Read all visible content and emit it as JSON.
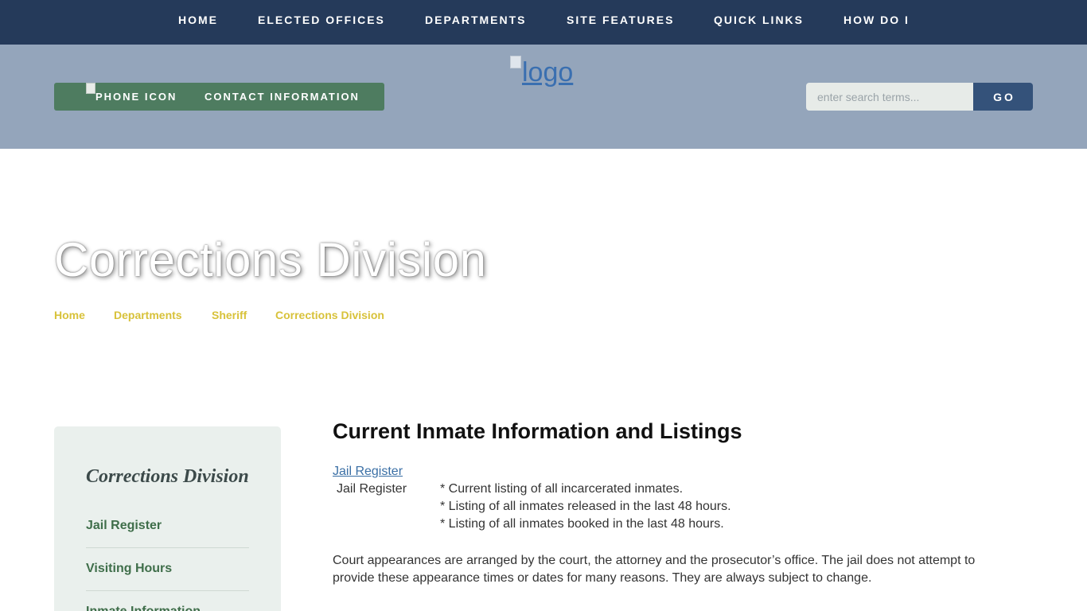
{
  "nav": {
    "items": [
      {
        "label": "HOME"
      },
      {
        "label": "ELECTED OFFICES"
      },
      {
        "label": "DEPARTMENTS"
      },
      {
        "label": "SITE FEATURES"
      },
      {
        "label": "QUICK LINKS"
      },
      {
        "label": "HOW DO I"
      }
    ]
  },
  "header": {
    "contact": {
      "phone_icon_alt": "PHONE ICON",
      "label": "CONTACT INFORMATION"
    },
    "logo_alt": "logo",
    "search": {
      "placeholder": "enter search terms...",
      "button_label": "GO"
    }
  },
  "hero": {
    "title": "Corrections Division",
    "breadcrumb": [
      "Home",
      "Departments",
      "Sheriff",
      "Corrections Division"
    ]
  },
  "sidebar": {
    "title": "Corrections Division",
    "items": [
      "Jail Register",
      "Visiting Hours",
      "Inmate Information"
    ]
  },
  "main": {
    "heading": "Current Inmate Information and Listings",
    "jail_link": "Jail Register",
    "jail_label": "Jail Register",
    "jail_items": [
      "* Current listing of all incarcerated inmates.",
      "* Listing of all inmates released in the last 48 hours.",
      "* Listing of all inmates booked in the last 48 hours."
    ],
    "court_text": "Court appearances are arranged by the court, the attorney and the prosecutor’s office. The jail does not attempt to provide these appearance times or dates for many reasons. They are always subject to change."
  },
  "colors": {
    "nav_bg": "#253a5a",
    "header_bg": "#94a5bb",
    "contact_btn": "#4e7c60",
    "search_btn": "#34527a",
    "breadcrumb": "#d8c23a",
    "sidebar_bg": "#eaf0ed",
    "sidebar_link": "#3f6e4a"
  }
}
